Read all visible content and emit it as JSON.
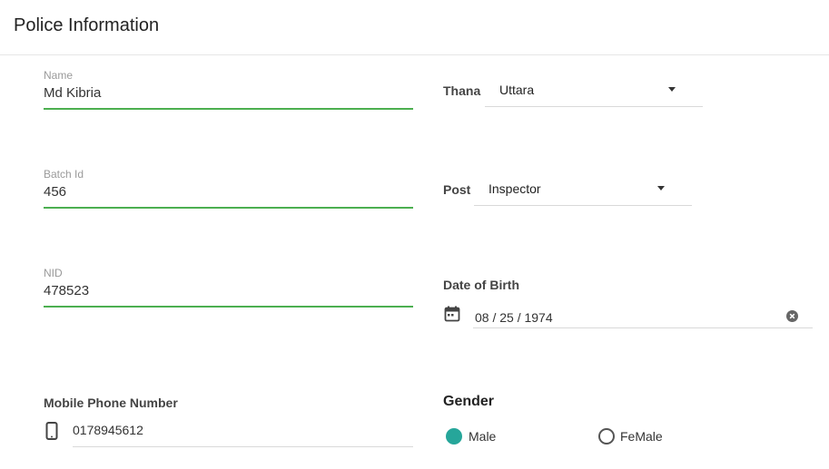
{
  "header": {
    "title": "Police Information"
  },
  "name_field": {
    "label": "Name",
    "value": "Md Kibria"
  },
  "batch_field": {
    "label": "Batch Id",
    "value": "456"
  },
  "nid_field": {
    "label": "NID",
    "value": "478523"
  },
  "mobile_field": {
    "label": "Mobile Phone Number",
    "value": "0178945612",
    "icon": "phone-icon"
  },
  "thana_field": {
    "label": "Thana",
    "value": "Uttara"
  },
  "post_field": {
    "label": "Post",
    "value": "Inspector"
  },
  "dob_field": {
    "label": "Date of Birth",
    "value": "08 / 25 / 1974",
    "icon": "calendar-icon"
  },
  "gender": {
    "label": "Gender",
    "options": [
      {
        "label": "Male",
        "selected": true
      },
      {
        "label": "FeMale",
        "selected": false
      }
    ]
  },
  "colors": {
    "focus_underline": "#4caf50",
    "radio_accent": "#26a69a"
  }
}
